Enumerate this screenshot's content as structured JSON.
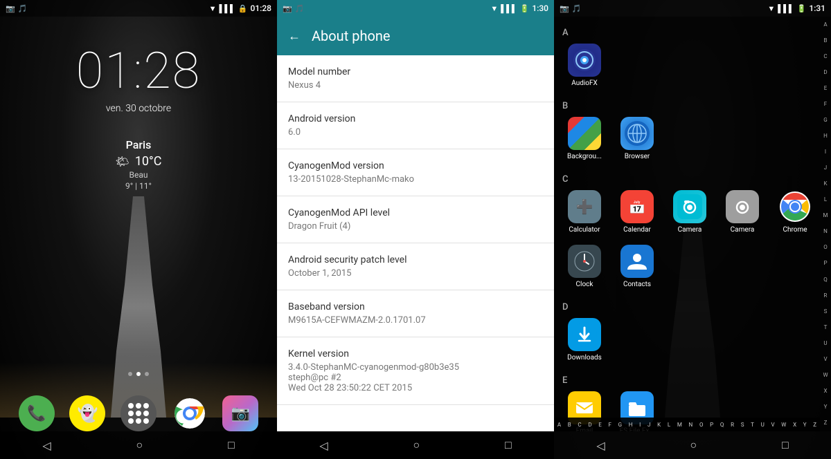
{
  "panel1": {
    "status_bar": {
      "left_icons": "📷 🎵",
      "time": "01:28",
      "right_icons": "▼ 🔒 🔋"
    },
    "clock": "01:28",
    "date": "ven. 30 octobre",
    "weather": {
      "city": "Paris",
      "condition": "Beau",
      "temp": "10°C",
      "range": "9° | 11°"
    },
    "dock": [
      {
        "name": "Phone",
        "icon": "📞",
        "bg": "#4caf50"
      },
      {
        "name": "Snapchat",
        "icon": "👻",
        "bg": "#ffeb00"
      },
      {
        "name": "Apps",
        "icon": "⋯",
        "bg": "#555"
      },
      {
        "name": "Chrome",
        "icon": "🌐",
        "bg": "transparent"
      },
      {
        "name": "Camera",
        "icon": "📷",
        "bg": "transparent"
      }
    ],
    "nav": [
      "◁",
      "○",
      "□"
    ]
  },
  "panel2": {
    "status_bar": {
      "time": "1:30"
    },
    "header": {
      "back_label": "←",
      "title": "About phone"
    },
    "items": [
      {
        "label": "Model number",
        "value": "Nexus 4"
      },
      {
        "label": "Android version",
        "value": "6.0"
      },
      {
        "label": "CyanogenMod version",
        "value": "13-20151028-StephanMc-mako"
      },
      {
        "label": "CyanogenMod API level",
        "value": "Dragon Fruit (4)"
      },
      {
        "label": "Android security patch level",
        "value": "October 1, 2015"
      },
      {
        "label": "Baseband version",
        "value": "M9615A-CEFWMAZM-2.0.1701.07"
      },
      {
        "label": "Kernel version",
        "value": "3.4.0-StephanMC-cyanogenmod-g80b3e35\nsteph@pc #2\nWed Oct 28 23:50:22 CET 2015"
      }
    ],
    "nav": [
      "◁",
      "○",
      "□"
    ]
  },
  "panel3": {
    "status_bar": {
      "time": "1:31"
    },
    "sections": [
      {
        "letter": "A",
        "apps": [
          {
            "name": "AudioFX",
            "icon": "🎵",
            "color": "#1a237e"
          }
        ]
      },
      {
        "letter": "B",
        "apps": [
          {
            "name": "Backgrou...",
            "icon": "🖼",
            "color": "multi"
          },
          {
            "name": "Browser",
            "icon": "🌐",
            "color": "#1565c0"
          }
        ]
      },
      {
        "letter": "C",
        "apps": [
          {
            "name": "Calculator",
            "icon": "🧮",
            "color": "#607d8b"
          },
          {
            "name": "Calendar",
            "icon": "📅",
            "color": "#f44336"
          },
          {
            "name": "Camera",
            "icon": "📷",
            "color": "#00bcd4"
          },
          {
            "name": "Camera",
            "icon": "📷",
            "color": "#9e9e9e"
          },
          {
            "name": "Chrome",
            "icon": "🔵",
            "color": "chrome"
          }
        ]
      },
      {
        "letter": "",
        "apps": [
          {
            "name": "Clock",
            "icon": "🕐",
            "color": "#37474f"
          },
          {
            "name": "Contacts",
            "icon": "👤",
            "color": "#1976d2"
          }
        ]
      },
      {
        "letter": "D",
        "apps": [
          {
            "name": "Downloads",
            "icon": "⬇",
            "color": "#039be5"
          }
        ]
      },
      {
        "letter": "E",
        "apps": [
          {
            "name": "Email",
            "icon": "✉",
            "color": "#ffcc02"
          },
          {
            "name": "ES File Ex...",
            "icon": "📁",
            "color": "#2196f3"
          }
        ]
      }
    ],
    "alpha": [
      "A",
      "B",
      "C",
      "D",
      "E",
      "F",
      "G",
      "H",
      "I",
      "J",
      "K",
      "L",
      "M",
      "N",
      "O",
      "P",
      "Q",
      "R",
      "S",
      "T",
      "U",
      "V",
      "W",
      "X",
      "Y",
      "Z"
    ],
    "bottom_alpha": [
      "A",
      "B",
      "C",
      "D",
      "E",
      "F",
      "G",
      "H",
      "I",
      "J",
      "K",
      "L",
      "M",
      "N",
      "O",
      "P",
      "Q",
      "R",
      "S",
      "T",
      "U",
      "V",
      "W",
      "X",
      "Y",
      "Z"
    ],
    "nav": [
      "◁",
      "○",
      "□"
    ]
  }
}
